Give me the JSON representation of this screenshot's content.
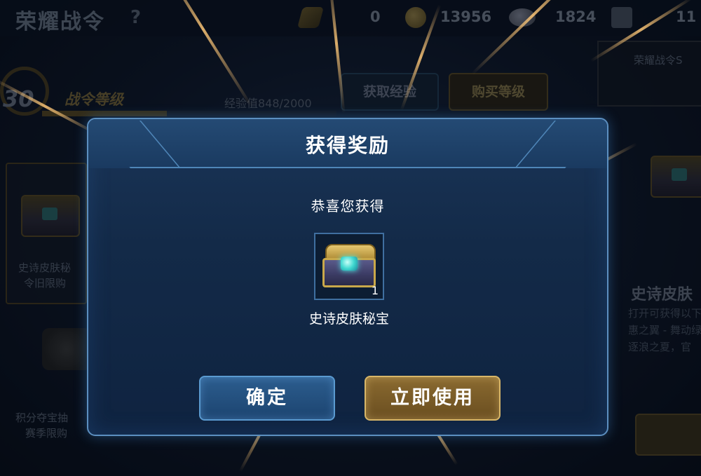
{
  "page": {
    "title": "荣耀战令",
    "help": "?"
  },
  "currencies": [
    {
      "name": "token-icon",
      "value": "0"
    },
    {
      "name": "gold-coin-icon",
      "value": "13956"
    },
    {
      "name": "gem-icon",
      "value": "1824"
    },
    {
      "name": "ticket-icon",
      "value": "11"
    }
  ],
  "pass": {
    "level": "30",
    "level_label": "战令等级",
    "exp_text": "经验值848/2000",
    "exp_progress": 0.424,
    "get_exp_button": "获取经验",
    "buy_level_button": "购买等级"
  },
  "background_cards": {
    "left_card_line1": "史诗皮肤秘",
    "left_card_line2": "令旧限购",
    "left_bottom_line1": "积分夺宝抽",
    "left_bottom_line2": "赛季限购",
    "right_card_line1": "荣耀战令S",
    "right_title": "史诗皮肤",
    "right_desc_line1": "打开可获得以下",
    "right_desc_line2": "惠之翼 - 舞动绿茵",
    "right_desc_line3": "逐浪之夏，官"
  },
  "dialog": {
    "title": "获得奖励",
    "subtitle": "恭喜您获得",
    "reward": {
      "icon": "epic-skin-chest-icon",
      "count": "1",
      "name": "史诗皮肤秘宝"
    },
    "confirm_button": "确定",
    "use_now_button": "立即使用"
  },
  "colors": {
    "dialog_border": "#5c8fc0",
    "confirm_button": "#2c5d8e",
    "use_button": "#8a6a30",
    "text": "#ffffff"
  }
}
